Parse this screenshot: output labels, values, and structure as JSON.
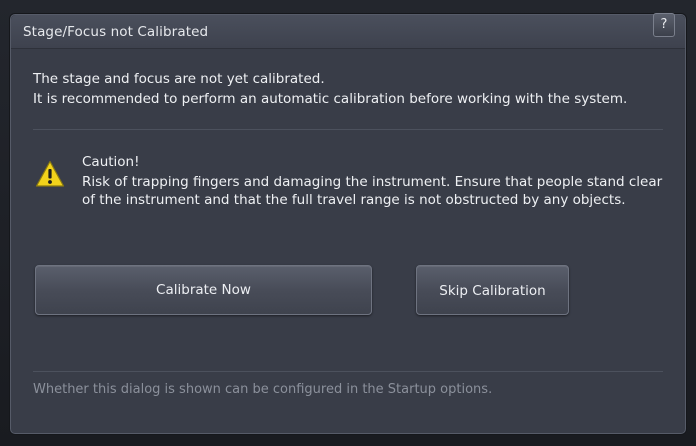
{
  "dialog": {
    "title": "Stage/Focus not Calibrated",
    "help_label": "?",
    "intro_line1": "The stage and focus are not yet calibrated.",
    "intro_line2": "It is recommended to perform an automatic calibration before working with the system.",
    "caution_title": "Caution!",
    "caution_text": "Risk of trapping fingers and damaging the instrument. Ensure that people stand clear of the instrument and that the full travel range is not obstructed by any objects.",
    "calibrate_label": "Calibrate Now",
    "skip_label": "Skip Calibration",
    "footer_note": "Whether this dialog is shown can be configured in the Startup options."
  },
  "icons": {
    "warning": "warning-triangle-icon"
  },
  "colors": {
    "dialog_background": "#393d48",
    "warning_yellow": "#f2d31b",
    "footer_text": "#8b909b"
  }
}
